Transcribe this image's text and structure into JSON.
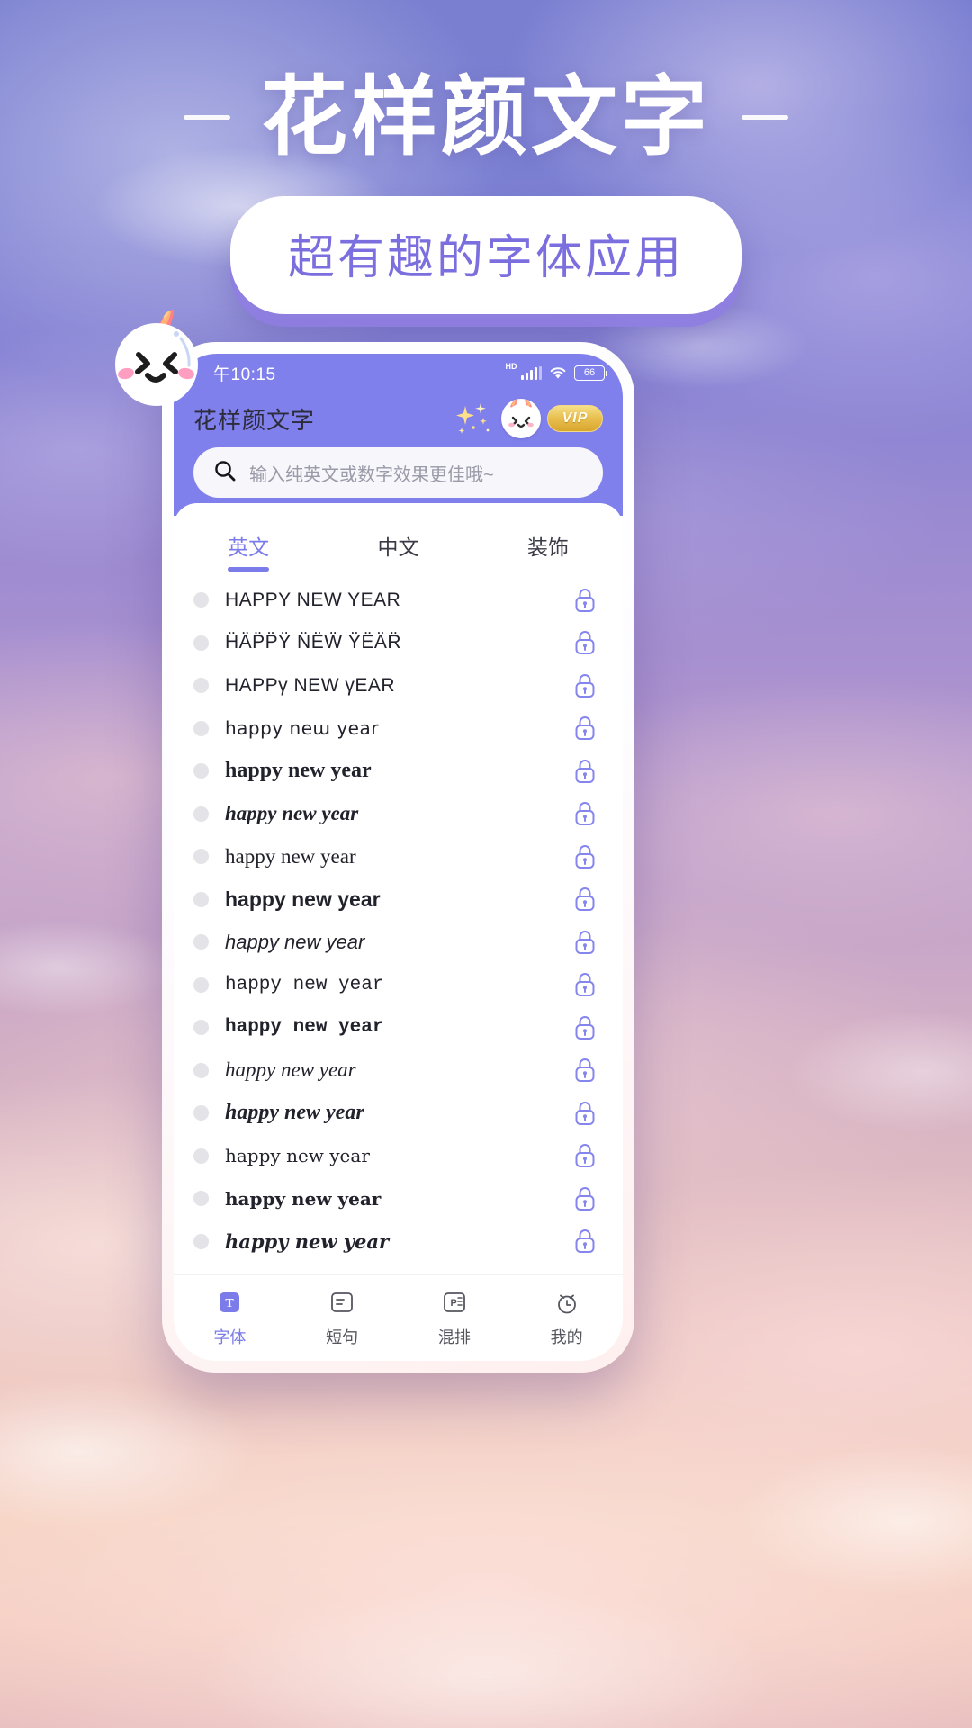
{
  "hero": {
    "title": "花样颜文字",
    "subtitle": "超有趣的字体应用"
  },
  "phone": {
    "status_bar": {
      "time": "午10:15",
      "hd_label": "HD",
      "battery_level": "66",
      "icons": [
        "hd-icon",
        "signal-icon",
        "wifi-icon",
        "battery-icon"
      ]
    },
    "header": {
      "title": "花样颜文字",
      "vip_label": "VIP",
      "icons": [
        "sparkles-icon",
        "avatar-icon",
        "vip-badge-icon"
      ]
    },
    "search": {
      "placeholder": "输入纯英文或数字效果更佳哦~",
      "value": "",
      "icon": "search-icon"
    },
    "tabs": [
      {
        "label": "英文",
        "active": true
      },
      {
        "label": "中文",
        "active": false
      },
      {
        "label": "装饰",
        "active": false
      }
    ],
    "font_rows": [
      {
        "text": "HAPPY NEW YEAR",
        "style": "f-sans",
        "locked": true
      },
      {
        "text": "ḦÄP̈P̈Ÿ N̈ËẄ ŸËÄR̈",
        "style": "f-sans-dia",
        "locked": true
      },
      {
        "text": "HAPPγ NEW γEAR",
        "style": "f-gamma",
        "locked": true
      },
      {
        "text": "happy neա year",
        "style": "f-round",
        "locked": true
      },
      {
        "text": "happy new year",
        "style": "f-serif-b",
        "locked": true
      },
      {
        "text": "happy new year",
        "style": "f-serif-bi",
        "locked": true
      },
      {
        "text": "happy new year",
        "style": "f-serif",
        "locked": true
      },
      {
        "text": "happy new year",
        "style": "f-sans-b",
        "locked": true
      },
      {
        "text": "happy new year",
        "style": "f-sans-i",
        "locked": true
      },
      {
        "text": "happy new year",
        "style": "f-mono",
        "locked": true
      },
      {
        "text": "happy new year",
        "style": "f-mono-b",
        "locked": true
      },
      {
        "text": "happy new year",
        "style": "f-serif-i",
        "locked": true
      },
      {
        "text": "happy new year",
        "style": "f-serif-bi2",
        "locked": true
      },
      {
        "text": "happy new year",
        "style": "f-goth",
        "locked": true
      },
      {
        "text": "happy new year",
        "style": "f-goth-b",
        "locked": true
      },
      {
        "text": "happy new year",
        "style": "f-script",
        "locked": true
      }
    ],
    "bottom_nav": [
      {
        "label": "字体",
        "icon": "font-t-icon",
        "active": true
      },
      {
        "label": "短句",
        "icon": "phrase-icon",
        "active": false
      },
      {
        "label": "混排",
        "icon": "mix-icon",
        "active": false
      },
      {
        "label": "我的",
        "icon": "alarm-icon",
        "active": false
      }
    ]
  },
  "colors": {
    "brand_purple": "#8080ec",
    "accent_purple": "#7b7bea",
    "vip_gold": "#e8bf4e",
    "hero_text": "#ffffff",
    "subtitle_text": "#7b6ede"
  }
}
